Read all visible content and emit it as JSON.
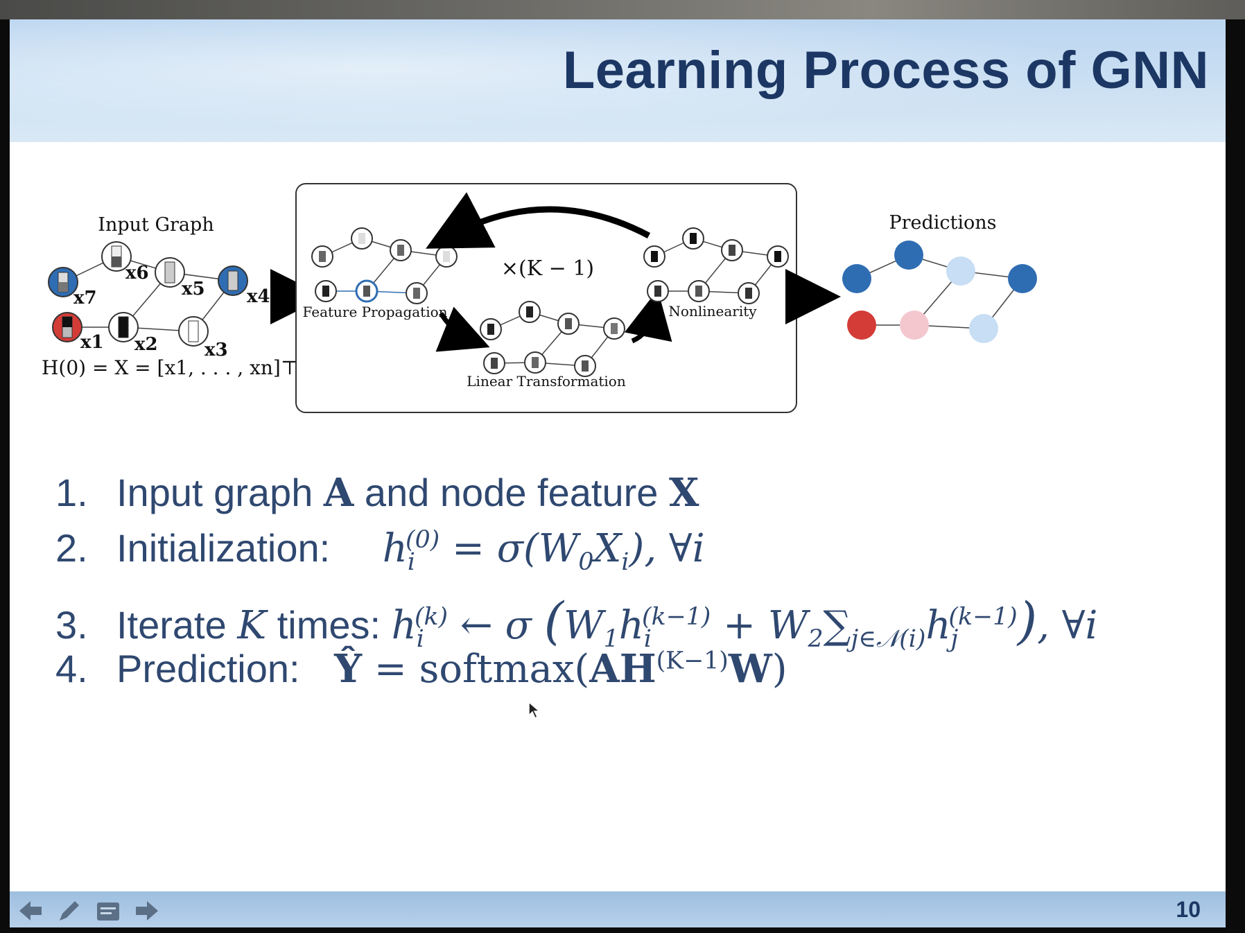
{
  "slide": {
    "title": "Learning Process of GNN",
    "page_number": "10"
  },
  "figure": {
    "input_graph_label": "Input Graph",
    "predictions_label": "Predictions",
    "feature_propagation_label": "Feature Propagation",
    "linear_transformation_label": "Linear Transformation",
    "nonlinearity_label": "Nonlinearity",
    "repeat_label": "×(K − 1)",
    "node_labels": [
      "x7",
      "x6",
      "x5",
      "x4",
      "x1",
      "x2",
      "x3"
    ],
    "h0_formula": "H(0) = X = [x1, . . . , xn]⊤"
  },
  "steps": [
    {
      "num": "1.",
      "text": "Input graph",
      "sym_a": "A",
      "mid": "and node feature",
      "sym_x": "X"
    },
    {
      "num": "2.",
      "text": "Initialization:"
    },
    {
      "num": "3.",
      "text": "Iterate",
      "sym_k": "K",
      "after": "times:"
    },
    {
      "num": "4.",
      "text": "Prediction:",
      "softmax": "softmax"
    }
  ],
  "nav": {
    "icons": [
      "arrow-left-icon",
      "pen-icon",
      "notes-icon",
      "arrow-right-icon"
    ]
  },
  "colors": {
    "title": "#1c3764",
    "text": "#2f4870",
    "node_blue": "#2f6db3",
    "node_light_blue": "#c7def4",
    "node_red": "#d43c37",
    "node_pink": "#f4c7cf"
  }
}
